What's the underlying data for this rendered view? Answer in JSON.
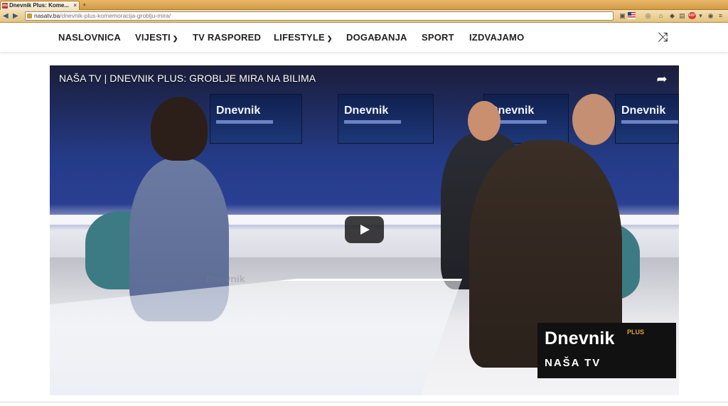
{
  "browser": {
    "tab_title": "Dnevnik Plus: Kome...",
    "tab_favicon": "ntv",
    "url_host": "nasatv.ba",
    "url_path": "/dnevnik-plus-komemoracija-groblju-mira/"
  },
  "site": {
    "menu": [
      {
        "label": "NASLOVNICA",
        "has_dropdown": false
      },
      {
        "label": "VIJESTI",
        "has_dropdown": true
      },
      {
        "label": "TV RASPORED",
        "has_dropdown": false
      },
      {
        "label": "LIFESTYLE",
        "has_dropdown": true
      },
      {
        "label": "DOGAĐANJA",
        "has_dropdown": false
      },
      {
        "label": "SPORT",
        "has_dropdown": false
      },
      {
        "label": "IZDVAJAMO",
        "has_dropdown": false
      }
    ],
    "shuffle_icon": "shuffle-icon"
  },
  "video": {
    "title": "NAŠA TV | DNEVNIK PLUS: GROBLJE MIRA NA BILIMA",
    "screen_logo": "Dnevnik",
    "brand_main": "Dnevnik",
    "brand_plus": "PLUS",
    "brand_sub": "NAŠA TV",
    "desk_text": "Dnevnik"
  },
  "colors": {
    "brand_plus": "#e0a13a",
    "studio_blue": "#243b87"
  }
}
